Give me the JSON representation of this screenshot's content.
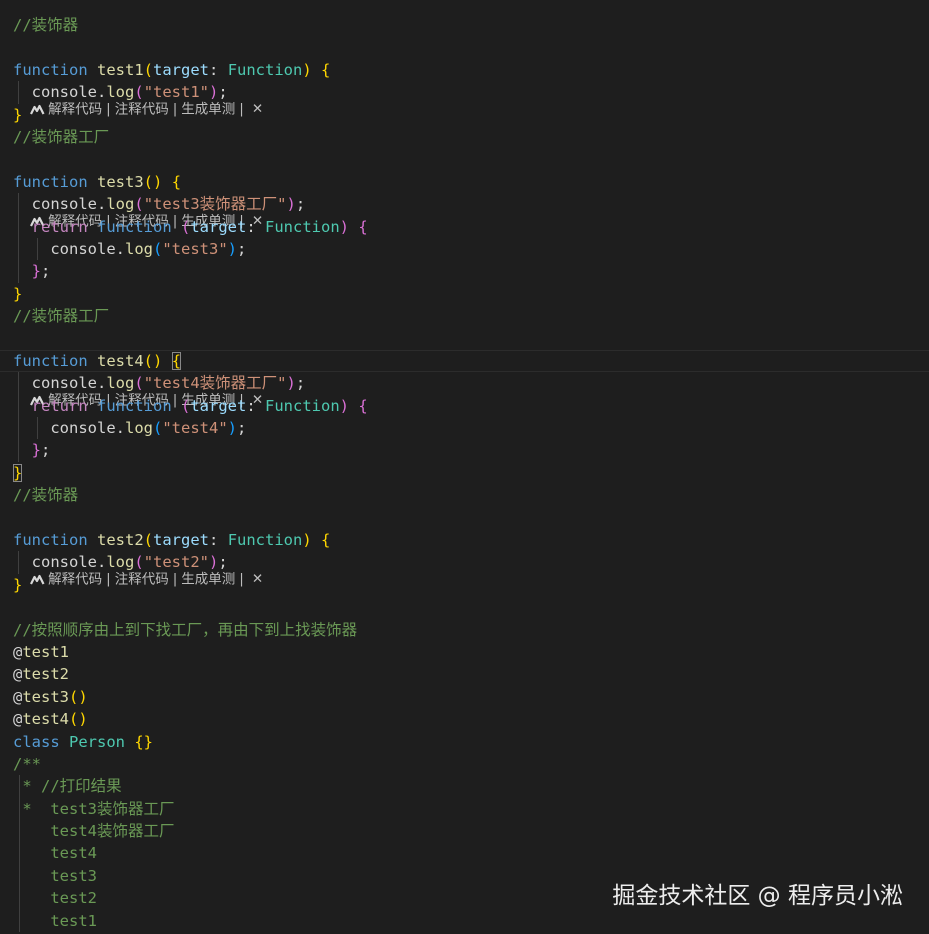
{
  "colors": {
    "background": "#1e1e1e",
    "comment": "#6a9955",
    "keyword": "#569cd6",
    "control_keyword": "#c586c0",
    "function_name": "#dcdcaa",
    "parameter": "#9cdcfe",
    "type": "#4ec9b0",
    "string": "#ce9178",
    "bracket_level1": "#ffd700",
    "bracket_level2": "#da70d6",
    "bracket_level3": "#179fff",
    "codelens": "#bdbdbd"
  },
  "codelens": {
    "icon": "codelens-logo-icon",
    "explain": "解释代码",
    "annotate": "注释代码",
    "unit_test": "生成单测",
    "separator": "|",
    "close": "✕"
  },
  "lines": [
    {
      "kind": "code",
      "tokens": [
        {
          "t": "cm",
          "v": "//装饰器"
        }
      ]
    },
    {
      "kind": "lens"
    },
    {
      "kind": "code",
      "tokens": [
        {
          "t": "kw",
          "v": "function "
        },
        {
          "t": "fn",
          "v": "test1"
        },
        {
          "t": "b1",
          "v": "("
        },
        {
          "t": "param",
          "v": "target"
        },
        {
          "t": "punc",
          "v": ": "
        },
        {
          "t": "type",
          "v": "Function"
        },
        {
          "t": "b1",
          "v": ")"
        },
        {
          "t": "punc",
          "v": " "
        },
        {
          "t": "b1",
          "v": "{"
        }
      ]
    },
    {
      "kind": "code",
      "guides": [
        1
      ],
      "tokens": [
        {
          "t": "plain",
          "v": "  console"
        },
        {
          "t": "punc",
          "v": "."
        },
        {
          "t": "fn",
          "v": "log"
        },
        {
          "t": "b2",
          "v": "("
        },
        {
          "t": "str",
          "v": "\"test1\""
        },
        {
          "t": "b2",
          "v": ")"
        },
        {
          "t": "punc",
          "v": ";"
        }
      ]
    },
    {
      "kind": "code",
      "tokens": [
        {
          "t": "b1",
          "v": "}"
        }
      ]
    },
    {
      "kind": "code",
      "tokens": [
        {
          "t": "cm",
          "v": "//装饰器工厂"
        }
      ]
    },
    {
      "kind": "lens"
    },
    {
      "kind": "code",
      "tokens": [
        {
          "t": "kw",
          "v": "function "
        },
        {
          "t": "fn",
          "v": "test3"
        },
        {
          "t": "b1",
          "v": "()"
        },
        {
          "t": "punc",
          "v": " "
        },
        {
          "t": "b1",
          "v": "{"
        }
      ]
    },
    {
      "kind": "code",
      "guides": [
        1
      ],
      "tokens": [
        {
          "t": "plain",
          "v": "  console"
        },
        {
          "t": "punc",
          "v": "."
        },
        {
          "t": "fn",
          "v": "log"
        },
        {
          "t": "b2",
          "v": "("
        },
        {
          "t": "str",
          "v": "\"test3装饰器工厂\""
        },
        {
          "t": "b2",
          "v": ")"
        },
        {
          "t": "punc",
          "v": ";"
        }
      ]
    },
    {
      "kind": "code",
      "guides": [
        1
      ],
      "tokens": [
        {
          "t": "plain",
          "v": "  "
        },
        {
          "t": "ctl",
          "v": "return "
        },
        {
          "t": "kw",
          "v": "function "
        },
        {
          "t": "b2",
          "v": "("
        },
        {
          "t": "param",
          "v": "target"
        },
        {
          "t": "punc",
          "v": ": "
        },
        {
          "t": "type",
          "v": "Function"
        },
        {
          "t": "b2",
          "v": ")"
        },
        {
          "t": "punc",
          "v": " "
        },
        {
          "t": "b2",
          "v": "{"
        }
      ]
    },
    {
      "kind": "code",
      "guides": [
        1,
        2
      ],
      "tokens": [
        {
          "t": "plain",
          "v": "    console"
        },
        {
          "t": "punc",
          "v": "."
        },
        {
          "t": "fn",
          "v": "log"
        },
        {
          "t": "b3",
          "v": "("
        },
        {
          "t": "str",
          "v": "\"test3\""
        },
        {
          "t": "b3",
          "v": ")"
        },
        {
          "t": "punc",
          "v": ";"
        }
      ]
    },
    {
      "kind": "code",
      "guides": [
        1
      ],
      "tokens": [
        {
          "t": "plain",
          "v": "  "
        },
        {
          "t": "b2",
          "v": "}"
        },
        {
          "t": "punc",
          "v": ";"
        }
      ]
    },
    {
      "kind": "code",
      "tokens": [
        {
          "t": "b1",
          "v": "}"
        }
      ]
    },
    {
      "kind": "code",
      "tokens": [
        {
          "t": "cm",
          "v": "//装饰器工厂"
        }
      ]
    },
    {
      "kind": "lens"
    },
    {
      "kind": "code",
      "current": true,
      "tokens": [
        {
          "t": "kw",
          "v": "function "
        },
        {
          "t": "fn",
          "v": "test4"
        },
        {
          "t": "b1",
          "v": "()"
        },
        {
          "t": "punc",
          "v": " "
        },
        {
          "t": "b1",
          "v": "{",
          "match": true
        }
      ]
    },
    {
      "kind": "code",
      "guides": [
        1
      ],
      "tokens": [
        {
          "t": "plain",
          "v": "  console"
        },
        {
          "t": "punc",
          "v": "."
        },
        {
          "t": "fn",
          "v": "log"
        },
        {
          "t": "b2",
          "v": "("
        },
        {
          "t": "str",
          "v": "\"test4装饰器工厂\""
        },
        {
          "t": "b2",
          "v": ")"
        },
        {
          "t": "punc",
          "v": ";"
        }
      ]
    },
    {
      "kind": "code",
      "guides": [
        1
      ],
      "tokens": [
        {
          "t": "plain",
          "v": "  "
        },
        {
          "t": "ctl",
          "v": "return "
        },
        {
          "t": "kw",
          "v": "function "
        },
        {
          "t": "b2",
          "v": "("
        },
        {
          "t": "param",
          "v": "target"
        },
        {
          "t": "punc",
          "v": ": "
        },
        {
          "t": "type",
          "v": "Function"
        },
        {
          "t": "b2",
          "v": ")"
        },
        {
          "t": "punc",
          "v": " "
        },
        {
          "t": "b2",
          "v": "{"
        }
      ]
    },
    {
      "kind": "code",
      "guides": [
        1,
        2
      ],
      "tokens": [
        {
          "t": "plain",
          "v": "    console"
        },
        {
          "t": "punc",
          "v": "."
        },
        {
          "t": "fn",
          "v": "log"
        },
        {
          "t": "b3",
          "v": "("
        },
        {
          "t": "str",
          "v": "\"test4\""
        },
        {
          "t": "b3",
          "v": ")"
        },
        {
          "t": "punc",
          "v": ";"
        }
      ]
    },
    {
      "kind": "code",
      "guides": [
        1
      ],
      "tokens": [
        {
          "t": "plain",
          "v": "  "
        },
        {
          "t": "b2",
          "v": "}"
        },
        {
          "t": "punc",
          "v": ";"
        }
      ]
    },
    {
      "kind": "code",
      "tokens": [
        {
          "t": "b1",
          "v": "}",
          "match": true
        }
      ]
    },
    {
      "kind": "code",
      "tokens": [
        {
          "t": "cm",
          "v": "//装饰器"
        }
      ]
    },
    {
      "kind": "lens"
    },
    {
      "kind": "code",
      "tokens": [
        {
          "t": "kw",
          "v": "function "
        },
        {
          "t": "fn",
          "v": "test2"
        },
        {
          "t": "b1",
          "v": "("
        },
        {
          "t": "param",
          "v": "target"
        },
        {
          "t": "punc",
          "v": ": "
        },
        {
          "t": "type",
          "v": "Function"
        },
        {
          "t": "b1",
          "v": ")"
        },
        {
          "t": "punc",
          "v": " "
        },
        {
          "t": "b1",
          "v": "{"
        }
      ]
    },
    {
      "kind": "code",
      "guides": [
        1
      ],
      "tokens": [
        {
          "t": "plain",
          "v": "  console"
        },
        {
          "t": "punc",
          "v": "."
        },
        {
          "t": "fn",
          "v": "log"
        },
        {
          "t": "b2",
          "v": "("
        },
        {
          "t": "str",
          "v": "\"test2\""
        },
        {
          "t": "b2",
          "v": ")"
        },
        {
          "t": "punc",
          "v": ";"
        }
      ]
    },
    {
      "kind": "code",
      "tokens": [
        {
          "t": "b1",
          "v": "}"
        }
      ]
    },
    {
      "kind": "code",
      "tokens": []
    },
    {
      "kind": "code",
      "tokens": [
        {
          "t": "cm",
          "v": "//按照顺序由上到下找工厂，再由下到上找装饰器"
        }
      ]
    },
    {
      "kind": "code",
      "tokens": [
        {
          "t": "plain",
          "v": "@"
        },
        {
          "t": "fn",
          "v": "test1"
        }
      ]
    },
    {
      "kind": "code",
      "tokens": [
        {
          "t": "plain",
          "v": "@"
        },
        {
          "t": "fn",
          "v": "test2"
        }
      ]
    },
    {
      "kind": "code",
      "tokens": [
        {
          "t": "plain",
          "v": "@"
        },
        {
          "t": "fn",
          "v": "test3"
        },
        {
          "t": "b1",
          "v": "()"
        }
      ]
    },
    {
      "kind": "code",
      "tokens": [
        {
          "t": "plain",
          "v": "@"
        },
        {
          "t": "fn",
          "v": "test4"
        },
        {
          "t": "b1",
          "v": "()"
        }
      ]
    },
    {
      "kind": "code",
      "tokens": [
        {
          "t": "kw",
          "v": "class "
        },
        {
          "t": "type",
          "v": "Person "
        },
        {
          "t": "b1",
          "v": "{}"
        }
      ]
    },
    {
      "kind": "code",
      "tokens": [
        {
          "t": "cm",
          "v": "/**"
        }
      ]
    },
    {
      "kind": "code",
      "guides": [
        0
      ],
      "tokens": [
        {
          "t": "cm",
          "v": " * //打印结果"
        }
      ]
    },
    {
      "kind": "code",
      "guides": [
        0
      ],
      "tokens": [
        {
          "t": "cm",
          "v": " *  test3装饰器工厂"
        }
      ]
    },
    {
      "kind": "code",
      "guides": [
        0
      ],
      "tokens": [
        {
          "t": "cm",
          "v": "    test4装饰器工厂"
        }
      ]
    },
    {
      "kind": "code",
      "guides": [
        0
      ],
      "tokens": [
        {
          "t": "cm",
          "v": "    test4"
        }
      ]
    },
    {
      "kind": "code",
      "guides": [
        0
      ],
      "tokens": [
        {
          "t": "cm",
          "v": "    test3"
        }
      ]
    },
    {
      "kind": "code",
      "guides": [
        0
      ],
      "tokens": [
        {
          "t": "cm",
          "v": "    test2"
        }
      ]
    },
    {
      "kind": "code",
      "guides": [
        0
      ],
      "tokens": [
        {
          "t": "cm",
          "v": "    test1"
        }
      ]
    }
  ],
  "watermark": "掘金技术社区 @ 程序员小淞"
}
